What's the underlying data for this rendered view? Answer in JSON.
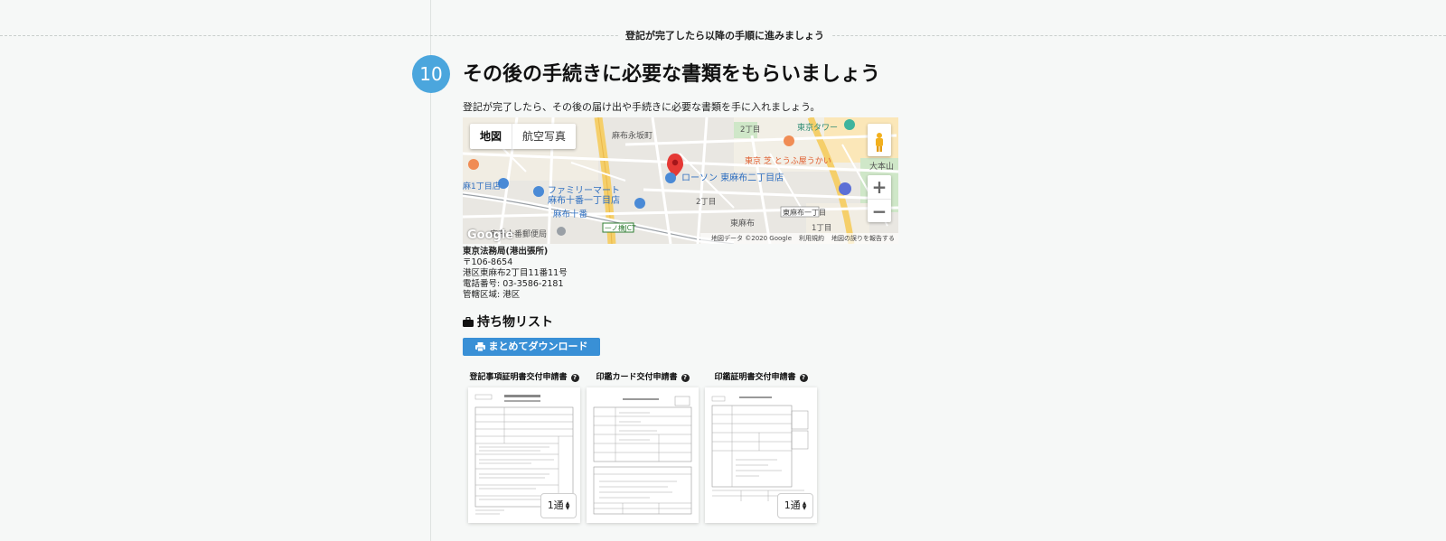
{
  "banner": "登記が完了したら以降の手順に進みましょう",
  "step": {
    "number": "10",
    "title": "その後の手続きに必要な書類をもらいましょう",
    "description": "登記が完了したら、その後の届け出や手続きに必要な書類を手に入れましょう。"
  },
  "map": {
    "type_buttons": [
      "地図",
      "航空写真"
    ],
    "zoom_in": "+",
    "zoom_out": "−",
    "logo": "Google",
    "footer": [
      "地図データ ©2020 Google",
      "利用規約",
      "地図の誤りを報告する"
    ],
    "labels": {
      "azabu_nagasaka": "麻布永坂町",
      "chome2_top": "2丁目",
      "tokyo_tower": "東京タワー",
      "tofuya": "東京 芝 とうふ屋うかい",
      "daihonzan": "大本山",
      "lawson": "ローソン 東麻布二丁目店",
      "familymart_1": "ファミリーマート",
      "familymart_2": "麻布十番一丁目店",
      "chome1_left": "麻1丁目店",
      "azabujuban": "麻布十番",
      "chome2_mid": "2丁目",
      "higashiazabu_1": "東麻布一丁目",
      "higashiazabu": "東麻布",
      "chome1_right": "1丁目",
      "ichinohashi": "一ノ橋JCT",
      "post_office": "麻布十番郵便局"
    }
  },
  "office": {
    "name": "東京法務局(港出張所)",
    "postal": "〒106-8654",
    "address": "港区東麻布2丁目11番11号",
    "phone": "電話番号: 03-3586-2181",
    "jurisdiction": "管轄区域: 港区"
  },
  "items": {
    "heading": "持ち物リスト",
    "download_label": "まとめてダウンロード",
    "documents": [
      {
        "title": "登記事項証明書交付申請書",
        "qty": "1通"
      },
      {
        "title": "印鑑カード交付申請書",
        "qty": ""
      },
      {
        "title": "印鑑証明書交付申請書",
        "qty": "1通"
      }
    ]
  },
  "colors": {
    "accent": "#4ba6dd",
    "button": "#3990d6",
    "background": "#f6f8f7"
  }
}
